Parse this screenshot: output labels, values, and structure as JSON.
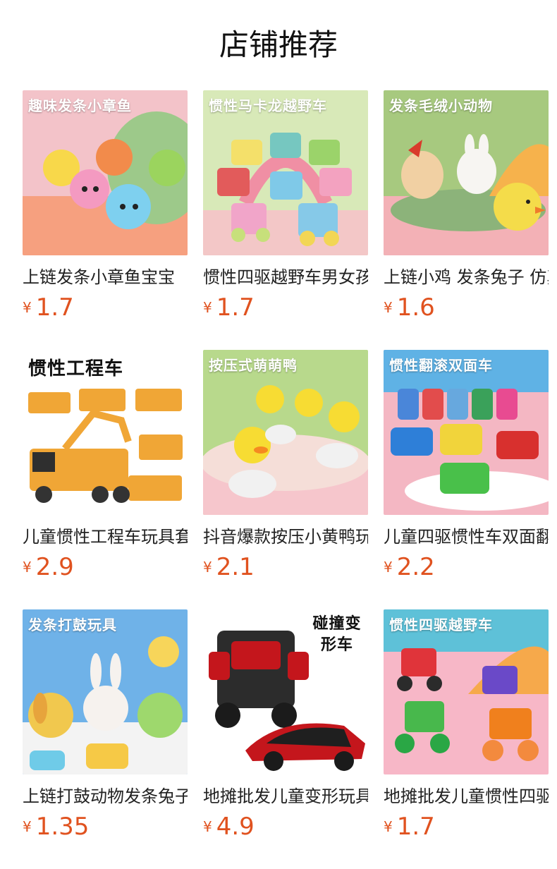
{
  "page": {
    "title": "店铺推荐",
    "currency": "¥"
  },
  "products": [
    {
      "name": "上链发条小章鱼宝宝",
      "price": "1.7",
      "banner": "趣味发条小章鱼",
      "bg": "#f3c3c9",
      "accent": "#8fc47b"
    },
    {
      "name": "惯性四驱越野车男女孩",
      "price": "1.7",
      "banner": "惯性马卡龙越野车",
      "bg": "#d8e9b8",
      "accent": "#f08fa4"
    },
    {
      "name": "上链小鸡 发条兔子 仿真",
      "price": "1.6",
      "banner": "发条毛绒小动物",
      "bg": "#a7c97f",
      "accent": "#f2b2b8"
    },
    {
      "name": "儿童惯性工程车玩具套装",
      "price": "2.9",
      "banner": "惯性工程车",
      "bg": "#ffffff",
      "accent": "#f0a636"
    },
    {
      "name": "抖音爆款按压小黄鸭玩具",
      "price": "2.1",
      "banner": "按压式萌萌鸭",
      "bg": "#b8d98c",
      "accent": "#f6c6cc"
    },
    {
      "name": "儿童四驱惯性车双面翻滚",
      "price": "2.2",
      "banner": "惯性翻滚双面车",
      "bg": "#f4b7c3",
      "accent": "#5fb2e5"
    },
    {
      "name": "上链打鼓动物发条兔子",
      "price": "1.35",
      "banner": "发条打鼓玩具",
      "bg": "#6fb2e8",
      "accent": "#f7d55a"
    },
    {
      "name": "地摊批发儿童变形玩具车",
      "price": "4.9",
      "banner": "碰撞变形车",
      "bg": "#ffffff",
      "accent": "#c4161c"
    },
    {
      "name": "地摊批发儿童惯性四驱车",
      "price": "1.7",
      "banner": "惯性四驱越野车",
      "bg": "#f7b7c7",
      "accent": "#5ec1d8"
    }
  ]
}
